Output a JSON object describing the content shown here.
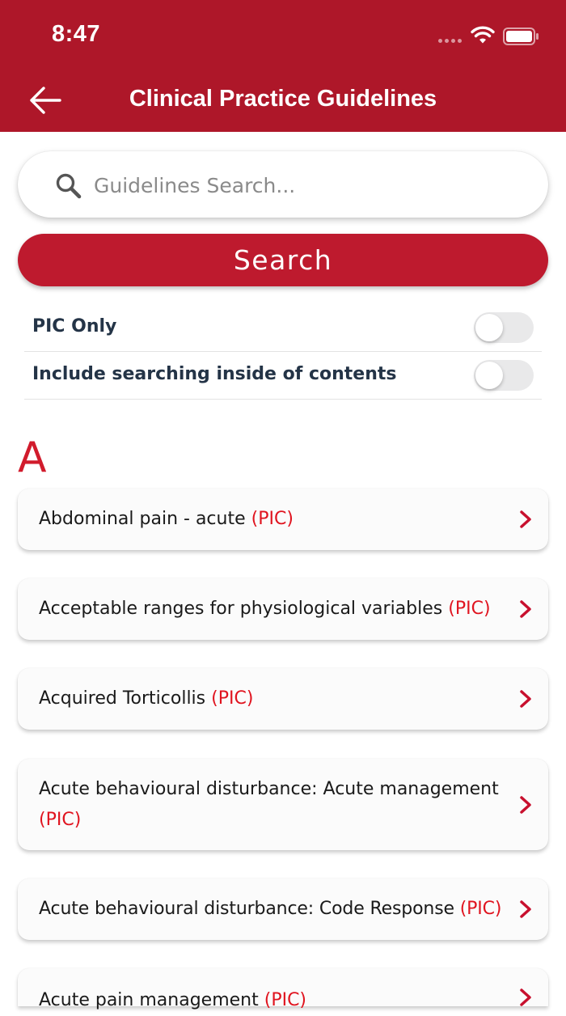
{
  "status_bar": {
    "time": "8:47"
  },
  "header": {
    "title": "Clinical Practice Guidelines",
    "back_icon": "arrow-left-icon"
  },
  "search": {
    "placeholder": "Guidelines Search...",
    "value": "",
    "button_label": "Search"
  },
  "toggles": [
    {
      "label": "PIC Only",
      "on": false
    },
    {
      "label": "Include searching inside of contents",
      "on": false
    }
  ],
  "section": {
    "letter": "A"
  },
  "guidelines": [
    {
      "title": "Abdominal pain - acute",
      "tag": "(PIC)"
    },
    {
      "title": "Acceptable ranges for physiological variables",
      "tag": "(PIC)"
    },
    {
      "title": "Acquired Torticollis",
      "tag": "(PIC)"
    },
    {
      "title": "Acute behavioural disturbance: Acute management",
      "tag": "(PIC)"
    },
    {
      "title": "Acute behavioural disturbance: Code Response",
      "tag": "(PIC)"
    },
    {
      "title": "Acute pain management",
      "tag": "(PIC)"
    }
  ],
  "colors": {
    "brand": "#ae1729",
    "button": "#be1a2e",
    "accent": "#e0141f"
  }
}
